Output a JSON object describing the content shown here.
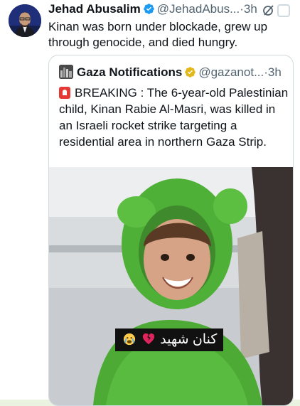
{
  "tweet": {
    "author_name": "Jehad Abusalim",
    "handle": "@JehadAbus...",
    "separator": "·",
    "time": "3h",
    "text": "Kinan was born under blockade, grew up through genocide, and died hungry."
  },
  "quote": {
    "author_name": "Gaza Notifications",
    "handle": "@gazanot...",
    "separator": "·",
    "time": "3h",
    "text": "BREAKING : The 6-year-old Palestinian child, Kinan Rabie Al-Masri, was killed in an Israeli rocket strike targeting a residential area in northern Gaza Strip.",
    "image_caption": "كنان شهيد"
  },
  "colors": {
    "page_background": "#e9f3df",
    "verified_badge_blue": "#1d9bf0",
    "verified_badge_gold": "#e2b719",
    "secondary_text": "#536471"
  },
  "icons": [
    "verified-badge-icon",
    "grok-icon",
    "more-icon",
    "siren-icon",
    "crying-face-icon",
    "broken-heart-icon"
  ]
}
